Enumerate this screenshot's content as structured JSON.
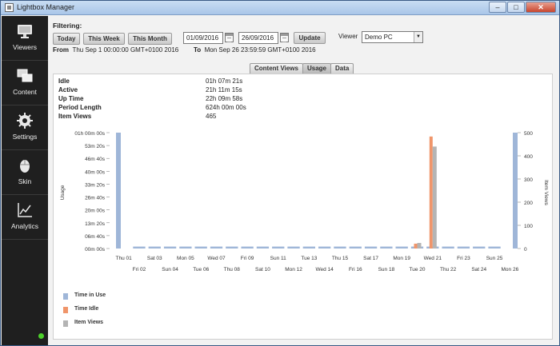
{
  "window": {
    "title": "Lightbox Manager",
    "controls": {
      "minimize": "–",
      "maximize": "□",
      "close": "✕"
    }
  },
  "sidebar": {
    "items": [
      {
        "label": "Viewers",
        "icon": "monitor-icon"
      },
      {
        "label": "Content",
        "icon": "content-windows-icon"
      },
      {
        "label": "Settings",
        "icon": "gear-icon"
      },
      {
        "label": "Skin",
        "icon": "mouse-icon"
      },
      {
        "label": "Analytics",
        "icon": "line-chart-icon"
      }
    ],
    "status_color": "#4cd12a"
  },
  "filters": {
    "label": "Filtering:",
    "today": "Today",
    "this_week": "This Week",
    "this_month": "This Month",
    "from_date": "01/09/2016",
    "to_date": "26/09/2016",
    "update": "Update",
    "viewer_label": "Viewer",
    "viewer_value": "Demo PC",
    "from_label": "From",
    "from_value": "Thu Sep 1 00:00:00 GMT+0100 2016",
    "to_label": "To",
    "to_value": "Mon Sep 26 23:59:59 GMT+0100 2016"
  },
  "tabs": [
    "Content Views",
    "Usage",
    "Data"
  ],
  "active_tab": "Usage",
  "stats": [
    {
      "key": "Idle",
      "value": "01h 07m 21s"
    },
    {
      "key": "Active",
      "value": "21h 11m 15s"
    },
    {
      "key": "Up Time",
      "value": "22h 09m 58s"
    },
    {
      "key": "Period Length",
      "value": "624h 00m 00s"
    },
    {
      "key": "Item Views",
      "value": "465"
    }
  ],
  "legend": [
    {
      "label": "Time in Use",
      "color": "#9fb6d8"
    },
    {
      "label": "Time Idle",
      "color": "#f0956a"
    },
    {
      "label": "Item Views",
      "color": "#b4b4b4"
    }
  ],
  "chart_data": {
    "type": "bar",
    "ylabel": "Usage",
    "y2label": "Item Views",
    "ylim_minutes": [
      0,
      60
    ],
    "y2lim": [
      0,
      500
    ],
    "yticks": [
      "00m 00s",
      "06m 40s",
      "13m 20s",
      "20m 00s",
      "26m 40s",
      "33m 20s",
      "40m 00s",
      "46m 40s",
      "53m 20s",
      "01h 00m 00s"
    ],
    "y2ticks": [
      "0",
      "100",
      "200",
      "300",
      "400",
      "500"
    ],
    "categories": [
      "Thu 01",
      "Fri 02",
      "Sat 03",
      "Sun 04",
      "Mon 05",
      "Tue 06",
      "Wed 07",
      "Thu 08",
      "Fri 09",
      "Sat 10",
      "Sun 11",
      "Mon 12",
      "Tue 13",
      "Wed 14",
      "Thu 15",
      "Fri 16",
      "Sat 17",
      "Sun 18",
      "Mon 19",
      "Tue 20",
      "Wed 21",
      "Thu 22",
      "Fri 23",
      "Sat 24",
      "Sun 25",
      "Mon 26"
    ],
    "series": [
      {
        "name": "Time in Use",
        "color": "#9fb6d8",
        "values_minutes": [
          60,
          1,
          1,
          1,
          1,
          1,
          1,
          1,
          1,
          1,
          1,
          1,
          1,
          1,
          1,
          1,
          1,
          1,
          1,
          1,
          1,
          1,
          1,
          1,
          1,
          60
        ]
      },
      {
        "name": "Time Idle",
        "color": "#f0956a",
        "values_minutes": [
          0,
          0,
          0,
          0,
          0,
          0,
          0,
          0,
          0,
          0,
          0,
          0,
          0,
          0,
          0,
          0,
          0,
          0,
          0,
          2.5,
          58,
          0,
          0,
          0,
          0,
          0
        ]
      },
      {
        "name": "Item Views",
        "color": "#b4b4b4",
        "values": [
          0,
          0,
          0,
          0,
          0,
          0,
          0,
          0,
          0,
          0,
          0,
          0,
          0,
          0,
          0,
          0,
          0,
          0,
          0,
          24,
          440,
          0,
          0,
          0,
          0,
          0
        ]
      }
    ],
    "grid": false
  }
}
